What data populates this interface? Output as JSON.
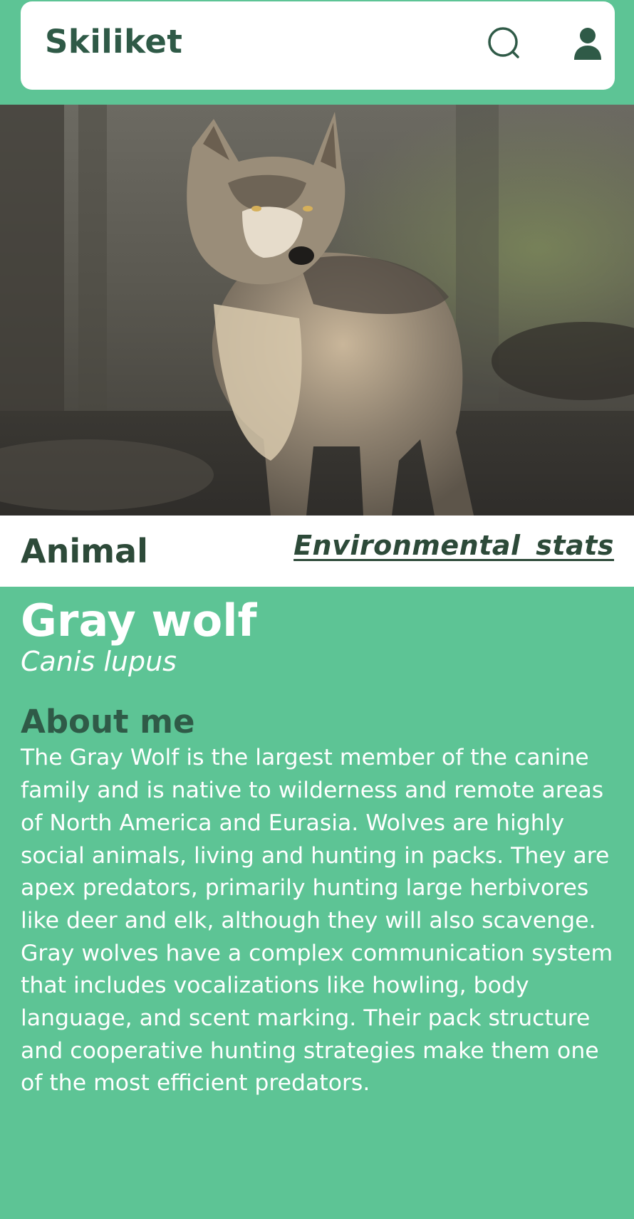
{
  "header": {
    "app_title": "Skiliket",
    "search_icon": "search-icon",
    "profile_icon": "user-icon"
  },
  "hero": {
    "image_subject": "gray wolf standing in forest"
  },
  "category": {
    "label": "Animal",
    "link_label": "Environmental stats"
  },
  "animal": {
    "common_name": "Gray wolf",
    "scientific_name": "Canis lupus"
  },
  "about": {
    "heading": "About me",
    "text": "The Gray Wolf is the largest member of the canine family and is native to wilderness and remote areas of North America and Eurasia. Wolves are highly social animals, living and hunting in packs. They are apex predators, primarily hunting large herbivores like deer and elk, although they will also scavenge. Gray wolves have a complex communication system that includes vocalizations like howling, body language, and scent marking. Their pack structure and cooperative hunting strategies make them one of the most efficient predators."
  },
  "colors": {
    "primary_green": "#5dc495",
    "dark_green": "#2f5a47",
    "text_dark": "#2d4a39",
    "white": "#ffffff"
  }
}
